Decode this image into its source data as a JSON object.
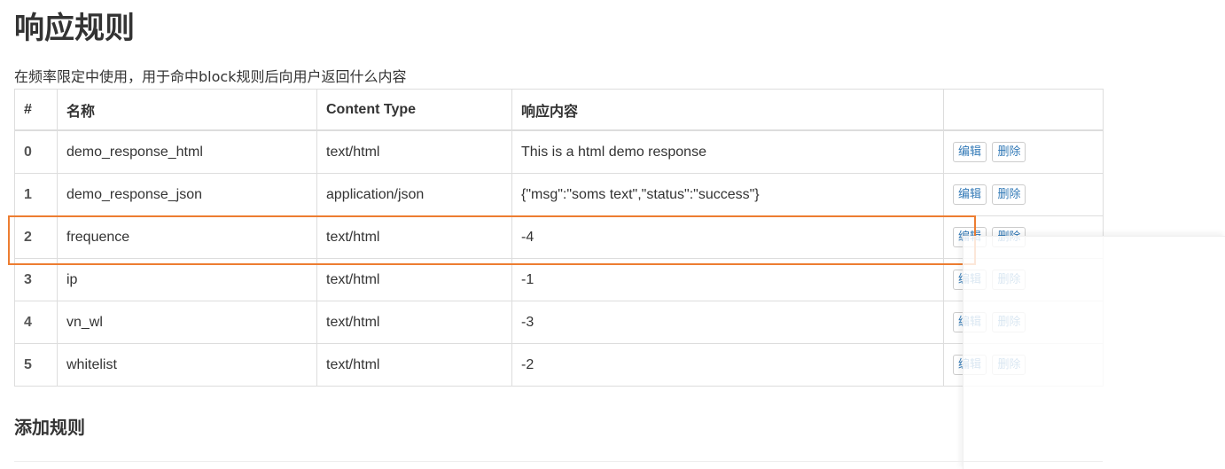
{
  "page": {
    "title": "响应规则",
    "description": "在频率限定中使用，用于命中block规则后向用户返回什么内容"
  },
  "table": {
    "headers": [
      "#",
      "名称",
      "Content Type",
      "响应内容",
      ""
    ],
    "rows": [
      {
        "index": "0",
        "name": "demo_response_html",
        "content_type": "text/html",
        "content": "This is a html demo response"
      },
      {
        "index": "1",
        "name": "demo_response_json",
        "content_type": "application/json",
        "content": "{\"msg\":\"soms text\",\"status\":\"success\"}"
      },
      {
        "index": "2",
        "name": "frequence",
        "content_type": "text/html",
        "content": "-4"
      },
      {
        "index": "3",
        "name": "ip",
        "content_type": "text/html",
        "content": "-1"
      },
      {
        "index": "4",
        "name": "vn_wl",
        "content_type": "text/html",
        "content": "-3"
      },
      {
        "index": "5",
        "name": "whitelist",
        "content_type": "text/html",
        "content": "-2"
      }
    ],
    "actions": {
      "edit_label": "编辑",
      "delete_label": "删除"
    }
  },
  "add_section": {
    "title": "添加规则"
  },
  "colors": {
    "highlight": "#ed7d31",
    "link": "#337ab7",
    "border": "#dddddd"
  }
}
